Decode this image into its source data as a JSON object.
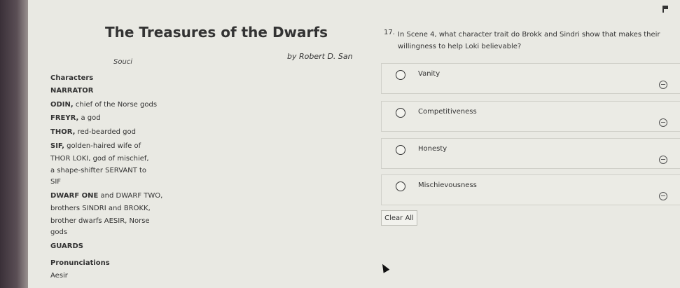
{
  "passage": {
    "title": "The Treasures of the Dwarfs",
    "source": "Souci",
    "author": "by Robert D. San",
    "lines": [
      {
        "bold": "Characters",
        "text": ""
      },
      {
        "bold": "NARRATOR",
        "text": ""
      },
      {
        "bold": "ODIN,",
        "text": " chief of the Norse gods"
      },
      {
        "bold": "FREYR,",
        "text": " a god"
      },
      {
        "bold": "THOR,",
        "text": " red-bearded god"
      },
      {
        "bold": "SIF,",
        "text": " golden-haired wife of"
      },
      {
        "bold": "",
        "text": "THOR LOKI, god of mischief,"
      },
      {
        "bold": "",
        "text": "a shape-shifter SERVANT to"
      },
      {
        "bold": "",
        "text": "SIF"
      },
      {
        "bold": "DWARF ONE",
        "text": " and DWARF TWO,"
      },
      {
        "bold": "",
        "text": "brothers SINDRI and BROKK,"
      },
      {
        "bold": "",
        "text": "brother dwarfs AESIR, Norse"
      },
      {
        "bold": "",
        "text": "gods"
      },
      {
        "bold": "GUARDS",
        "text": ""
      },
      {
        "bold": "Pronunciations",
        "text": ""
      },
      {
        "bold": "",
        "text": "Aesir"
      }
    ]
  },
  "question": {
    "number": "17.",
    "text": "In Scene 4, what character trait do Brokk and Sindri show that makes their willingness to help Loki believable?",
    "options": [
      {
        "label": "Vanity"
      },
      {
        "label": "Competitiveness"
      },
      {
        "label": "Honesty"
      },
      {
        "label": "Mischievousness"
      }
    ],
    "clear_label": "Clear All"
  },
  "icons": {
    "eliminate": "eliminate-icon",
    "flag": "flag-icon",
    "cursor": "mouse-pointer"
  }
}
